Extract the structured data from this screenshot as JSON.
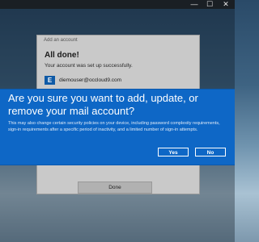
{
  "window_controls": {
    "minimize": "—",
    "maximize": "☐",
    "close": "✕"
  },
  "account_dialog": {
    "title": "Add an account",
    "heading": "All done!",
    "message": "Your account was set up successfully.",
    "account_icon_letter": "E",
    "account_email": "diemouser@occloud9.com",
    "done_label": "Done"
  },
  "prompt": {
    "heading": "Are you sure you want to add, update, or remove your mail account?",
    "body": "This may also change certain security policies on your device, including password complexity requirements, sign-in requirements after a specific period of inactivity, and a limited number of sign-in attempts.",
    "yes_label": "Yes",
    "no_label": "No"
  },
  "colors": {
    "banner": "#0e67c6",
    "exchange_icon": "#0f5aa6",
    "dialog": "#c9c9c9"
  }
}
